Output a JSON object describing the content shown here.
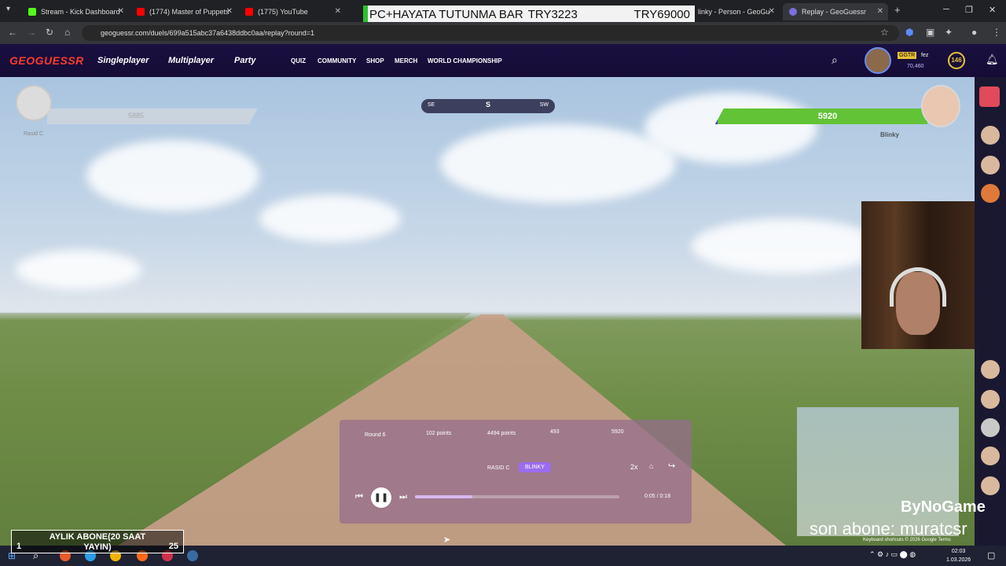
{
  "tabs": [
    {
      "label": "Stream - Kick Dashboard",
      "color": "#53fc18"
    },
    {
      "label": "(1774) Master of Puppets",
      "color": "#ff0000"
    },
    {
      "label": "(1775) YouTube",
      "color": "#ff0000"
    },
    {
      "label": "linky - Person - GeoGu",
      "color": "#6a5acd"
    },
    {
      "label": "Replay - GeoGuessr",
      "color": "#6a5acd"
    }
  ],
  "banner": {
    "text": "PC+HAYATA TUTUNMA BAR",
    "value1": "TRY3223",
    "value2": "TRY69000"
  },
  "url": "geoguessr.com/duels/699a515abc37a6438ddbc0aa/replay?round=1",
  "header": {
    "logo": "GEOGUESSR",
    "main_nav": [
      "Singleplayer",
      "Multiplayer",
      "Party"
    ],
    "sub_nav": [
      "QUIZ",
      "COMMUNITY",
      "SHOP",
      "MERCH",
      "WORLD CHAMPIONSHIP"
    ],
    "user_tag": "GGTR",
    "user_name": "fez",
    "coins": "70,460",
    "level": "146"
  },
  "hud": {
    "player1_hp": "5885",
    "player1_name": "Rasid C",
    "player1_hp_fraction": 0.82,
    "compass": {
      "left": "SE",
      "center": "S",
      "right": "SW"
    },
    "player2_hp": "5920",
    "player2_name": "Blinky"
  },
  "replay": {
    "round": "Round 6",
    "col1": "102 points",
    "col2": "4494 points",
    "col3": "493",
    "col4": "5920",
    "player_a": "RASID C",
    "player_b": "BLINKY",
    "speed": "2x",
    "time": "0:05 / 0:18",
    "progress": 0.28
  },
  "overlay": {
    "brand": "ByNoGame",
    "last_sub": "son abone: muratcsr",
    "sub_goal": "AYLIK ABONE(20 SAAT YAYIN)",
    "sub_goal_current": "1",
    "sub_goal_target": "25",
    "map_footer": "Keyboard shortcuts  © 2026 Google  Terms"
  },
  "taskbar": {
    "time": "02:03",
    "date": "1.03.2026"
  }
}
